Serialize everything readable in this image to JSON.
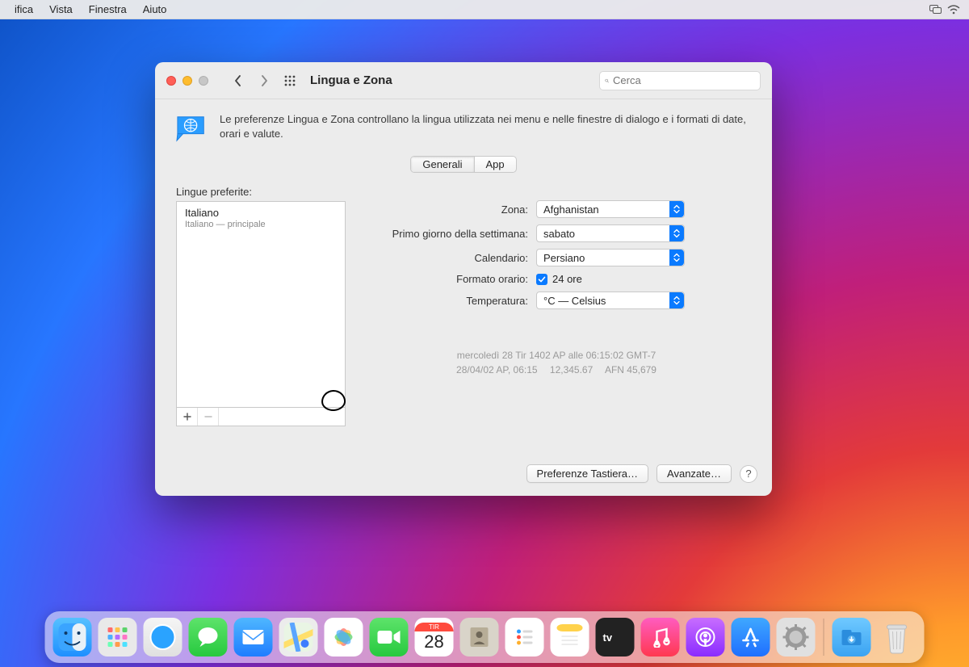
{
  "menubar": {
    "items": [
      "ifica",
      "Vista",
      "Finestra",
      "Aiuto"
    ]
  },
  "window": {
    "title": "Lingua e Zona",
    "search_placeholder": "Cerca",
    "description": "Le preferenze Lingua e Zona controllano la lingua utilizzata nei menu e nelle finestre di dialogo e i formati di date, orari e valute.",
    "tabs": {
      "general": "Generali",
      "app": "App",
      "active": "general"
    },
    "preferred_label": "Lingue preferite:",
    "languages": [
      {
        "name": "Italiano",
        "sub": "Italiano — principale"
      }
    ],
    "form": {
      "region_label": "Zona:",
      "region_value": "Afghanistan",
      "first_day_label": "Primo giorno della settimana:",
      "first_day_value": "sabato",
      "calendar_label": "Calendario:",
      "calendar_value": "Persiano",
      "time_format_label": "Formato orario:",
      "time_format_value": "24 ore",
      "time_format_checked": true,
      "temperature_label": "Temperatura:",
      "temperature_value": "°C — Celsius"
    },
    "preview": {
      "line1": "mercoledì 28 Tir 1402 AP alle 06:15:02 GMT-7",
      "line2": "28/04/02 AP, 06:15  12,345.67  AFN 45,679"
    },
    "footer": {
      "keyboard": "Preferenze Tastiera…",
      "advanced": "Avanzate…"
    }
  },
  "dock": {
    "calendar_weekday": "TIR",
    "calendar_day": "28"
  }
}
